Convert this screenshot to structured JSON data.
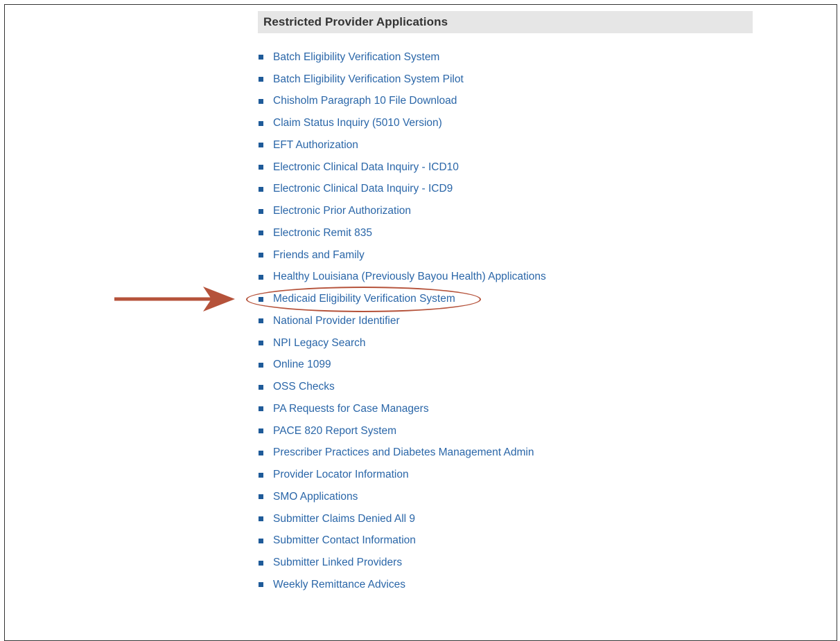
{
  "panel": {
    "title": "Restricted Provider Applications"
  },
  "applications": [
    "Batch Eligibility Verification System",
    "Batch Eligibility Verification System Pilot",
    "Chisholm Paragraph 10 File Download",
    "Claim Status Inquiry (5010 Version)",
    "EFT Authorization",
    "Electronic Clinical Data Inquiry - ICD10",
    "Electronic Clinical Data Inquiry - ICD9",
    "Electronic Prior Authorization",
    "Electronic Remit 835",
    "Friends and Family",
    "Healthy Louisiana (Previously Bayou Health) Applications",
    "Medicaid Eligibility Verification System",
    "National Provider Identifier",
    "NPI Legacy Search",
    "Online 1099",
    "OSS Checks",
    "PA Requests for Case Managers",
    "PACE 820 Report System",
    "Prescriber Practices and Diabetes Management Admin",
    "Provider Locator Information",
    "SMO Applications",
    "Submitter Claims Denied All 9",
    "Submitter Contact Information",
    "Submitter Linked Providers",
    "Weekly Remittance Advices"
  ],
  "annotation": {
    "highlighted_item": "Medicaid Eligibility Verification System",
    "color": "#b5523a",
    "icon": "right-arrow-icon"
  },
  "colors": {
    "link": "#2a66a8",
    "bullet": "#1f5b99",
    "header_bg": "#e6e6e6"
  }
}
